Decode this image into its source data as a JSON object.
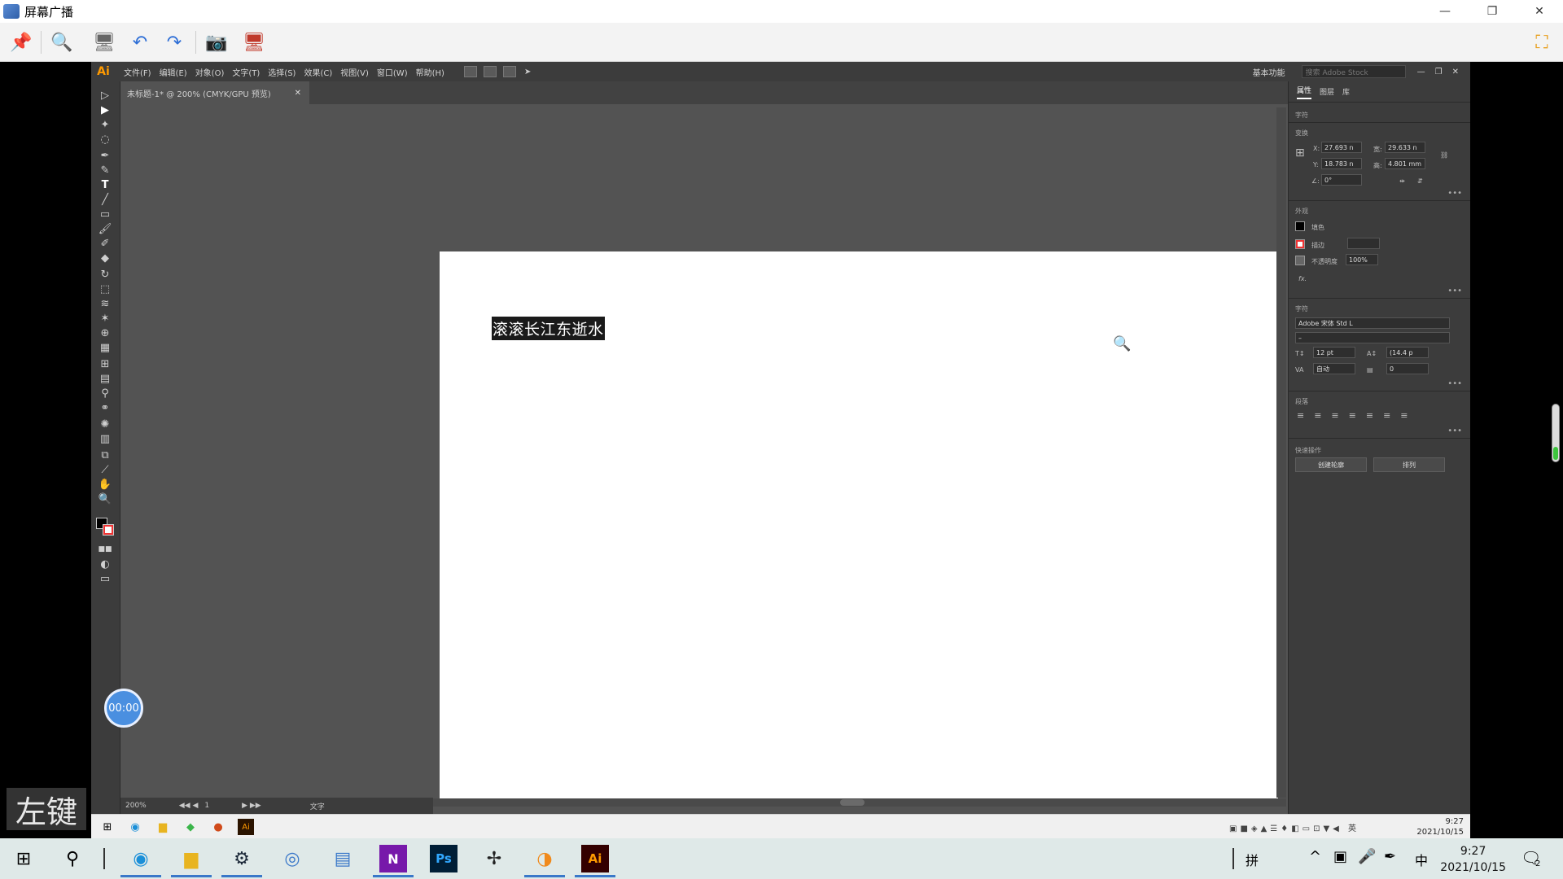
{
  "outer_window": {
    "title": "屏幕广播",
    "controls": [
      "—",
      "❐",
      "✕"
    ]
  },
  "ai": {
    "logo": "Ai",
    "menus": [
      "文件(F)",
      "编辑(E)",
      "对象(O)",
      "文字(T)",
      "选择(S)",
      "效果(C)",
      "视图(V)",
      "窗口(W)",
      "帮助(H)"
    ],
    "workspace": "基本功能",
    "search_placeholder": "搜索 Adobe Stock",
    "doc_tab": "未标题-1* @ 200% (CMYK/GPU 预览)",
    "canvas_text": "滚滚长江东逝水",
    "status": {
      "zoom": "200%",
      "page": "1",
      "tool": "文字"
    }
  },
  "panel": {
    "tabs": [
      "属性",
      "图层",
      "库"
    ],
    "section_type": "字符",
    "section_transform": "变换",
    "x": "27.693 n",
    "y": "18.783 n",
    "w": "29.633 n",
    "h": "4.801 mm",
    "angle": "0°",
    "section_appearance": "外观",
    "fill_label": "填色",
    "stroke_label": "描边",
    "opacity_label": "不透明度",
    "opacity": "100%",
    "fx": "fx.",
    "section_char": "字符",
    "font": "Adobe 宋体 Std L",
    "font_style": "–",
    "size": "12 pt",
    "leading": "(14.4 p",
    "tracking": "自动",
    "kerning": "0",
    "section_paragraph": "段落",
    "section_quick": "快速操作",
    "btn_outline": "创建轮廓",
    "btn_arrange": "排列"
  },
  "recorded_taskbar": {
    "time": "9:27",
    "date": "2021/10/15"
  },
  "timer": "00:00",
  "key_overlay": "左键",
  "host_taskbar": {
    "time": "9:27",
    "date": "2021/10/15",
    "ime": "拼",
    "lang": "中",
    "notif_count": "2"
  }
}
